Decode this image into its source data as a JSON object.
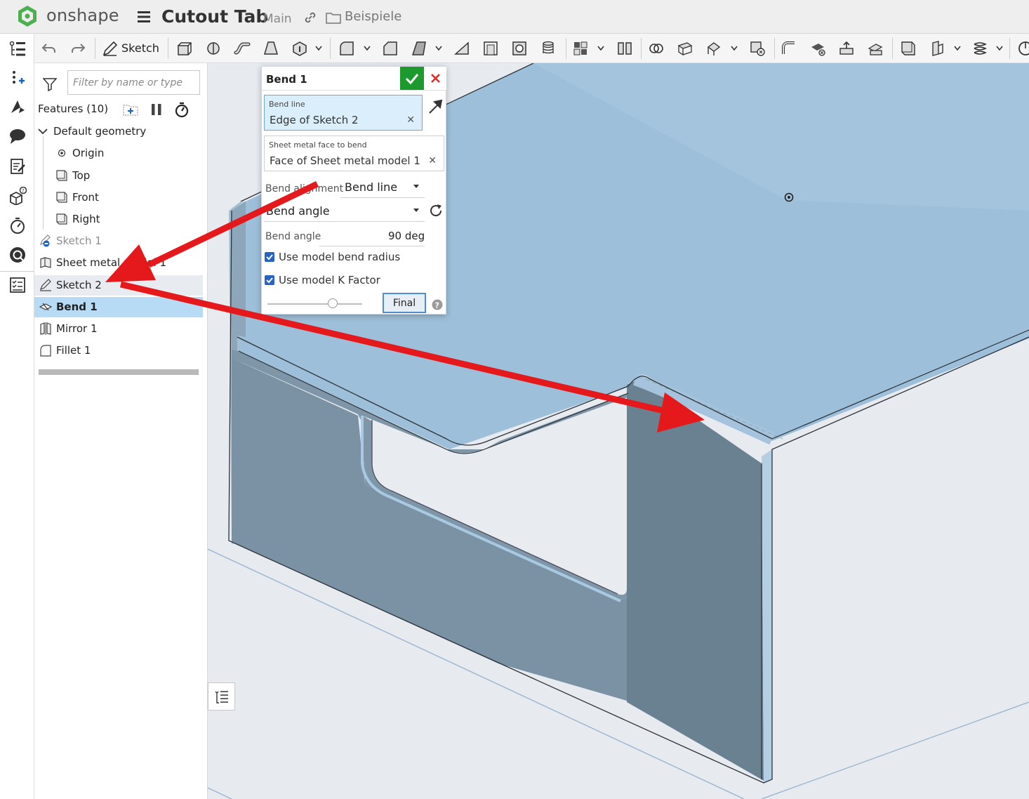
{
  "header": {
    "brand": "onshape",
    "doc_title": "Cutout Tab",
    "branch": "Main",
    "folder": "Beispiele"
  },
  "toolbar": {
    "sketch_label": "Sketch"
  },
  "feature_panel": {
    "filter_placeholder": "Filter by name or type",
    "features_label": "Features (10)",
    "tree": [
      {
        "label": "Default geometry",
        "icon": "chevron-down-icon"
      },
      {
        "label": "Origin",
        "icon": "origin-icon"
      },
      {
        "label": "Top",
        "icon": "plane-icon"
      },
      {
        "label": "Front",
        "icon": "plane-icon"
      },
      {
        "label": "Right",
        "icon": "plane-icon"
      },
      {
        "label": "Sketch 1",
        "icon": "sketch-suppressed-icon",
        "state": "dimmed"
      },
      {
        "label": "Sheet metal model 1",
        "icon": "sheet-metal-icon"
      },
      {
        "label": "Sketch 2",
        "icon": "sketch-icon",
        "state": "hover"
      },
      {
        "label": "Bend 1",
        "icon": "bend-icon",
        "state": "selected"
      },
      {
        "label": "Mirror 1",
        "icon": "mirror-icon"
      },
      {
        "label": "Fillet 1",
        "icon": "fillet-icon"
      }
    ]
  },
  "dialog": {
    "title": "Bend 1",
    "bend_line": {
      "label": "Bend line",
      "value": "Edge of Sketch 2"
    },
    "face": {
      "label": "Sheet metal face to bend",
      "value": "Face of Sheet metal model 1"
    },
    "alignment": {
      "label": "Bend alignment",
      "value": "Bend line"
    },
    "mode": {
      "value": "Bend angle"
    },
    "angle": {
      "label": "Bend angle",
      "value": "90 deg"
    },
    "use_radius": {
      "label": "Use model bend radius",
      "checked": true
    },
    "use_kfactor": {
      "label": "Use model K Factor",
      "checked": true
    },
    "final_label": "Final"
  },
  "colors": {
    "accent_green": "#1d9a2e",
    "selection_blue": "#b7dbf4",
    "annotation_red": "#e5191c",
    "part_face": "#9dbfd8",
    "part_side": "#6c8293"
  }
}
